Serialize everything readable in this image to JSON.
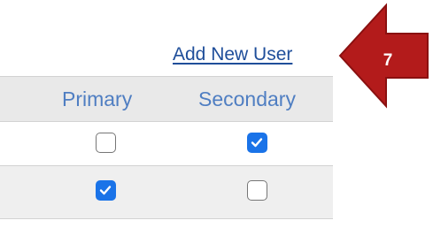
{
  "header_link": {
    "label": "Add New User"
  },
  "table": {
    "columns": [
      "Primary",
      "Secondary"
    ],
    "rows": [
      {
        "primary": false,
        "secondary": true
      },
      {
        "primary": true,
        "secondary": false
      }
    ]
  },
  "callout": {
    "number": "7",
    "color": "#b31b1b"
  },
  "colors": {
    "link": "#1f4e9a",
    "header_text": "#4f7ec2",
    "checkbox_checked": "#1a73e8"
  }
}
